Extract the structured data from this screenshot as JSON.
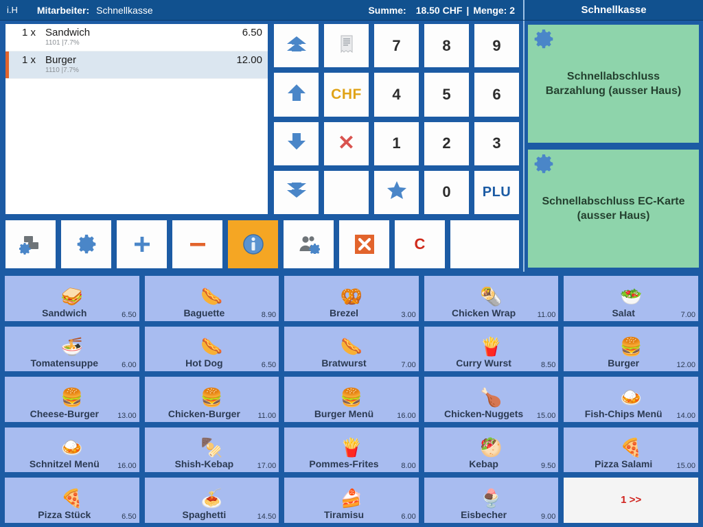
{
  "header": {
    "ih": "i.H",
    "employee_label": "Mitarbeiter:",
    "employee_value": "Schnellkasse",
    "sum_label": "Summe:",
    "sum_value": "18.50 CHF",
    "separator": "|",
    "quantity": "Menge: 2",
    "right_title": "Schnellkasse"
  },
  "receipt": {
    "lines": [
      {
        "qty": "1 x",
        "name": "Sandwich",
        "meta": "1101 |7.7%",
        "price": "6.50",
        "selected": false
      },
      {
        "qty": "1 x",
        "name": "Burger",
        "meta": "1110 |7.7%",
        "price": "12.00",
        "selected": true
      }
    ]
  },
  "keypad": {
    "keys": [
      {
        "name": "scroll-top-button",
        "icon": "double-up-arrow-icon",
        "label": ""
      },
      {
        "name": "receipt-button",
        "icon": "receipt-icon",
        "label": ""
      },
      {
        "name": "key-7",
        "icon": "",
        "label": "7"
      },
      {
        "name": "key-8",
        "icon": "",
        "label": "8"
      },
      {
        "name": "key-9",
        "icon": "",
        "label": "9"
      },
      {
        "name": "scroll-up-button",
        "icon": "up-arrow-icon",
        "label": ""
      },
      {
        "name": "currency-button",
        "icon": "",
        "label": "CHF",
        "style": "chf"
      },
      {
        "name": "key-4",
        "icon": "",
        "label": "4"
      },
      {
        "name": "key-5",
        "icon": "",
        "label": "5"
      },
      {
        "name": "key-6",
        "icon": "",
        "label": "6"
      },
      {
        "name": "scroll-down-button",
        "icon": "down-arrow-icon",
        "label": ""
      },
      {
        "name": "multiply-button",
        "icon": "",
        "label": "✕",
        "style": "xmark"
      },
      {
        "name": "key-1",
        "icon": "",
        "label": "1"
      },
      {
        "name": "key-2",
        "icon": "",
        "label": "2"
      },
      {
        "name": "key-3",
        "icon": "",
        "label": "3"
      },
      {
        "name": "scroll-bottom-button",
        "icon": "double-down-arrow-icon",
        "label": ""
      },
      {
        "name": "empty-key",
        "icon": "",
        "label": "",
        "blank": true
      },
      {
        "name": "favorite-button",
        "icon": "star-icon",
        "label": ""
      },
      {
        "name": "key-0",
        "icon": "",
        "label": "0"
      },
      {
        "name": "plu-button",
        "icon": "",
        "label": "PLU",
        "style": "plu"
      }
    ]
  },
  "toolbar": {
    "buttons": [
      {
        "name": "windows-settings-button",
        "icon": "windows-gear-icon",
        "label": "",
        "active": false
      },
      {
        "name": "settings-button",
        "icon": "gear-icon",
        "label": "",
        "active": false
      },
      {
        "name": "add-button",
        "icon": "plus-icon",
        "label": "",
        "active": false
      },
      {
        "name": "remove-button",
        "icon": "minus-icon",
        "label": "",
        "active": false
      },
      {
        "name": "info-button",
        "icon": "info-icon",
        "label": "",
        "active": true
      },
      {
        "name": "user-settings-button",
        "icon": "users-gear-icon",
        "label": "",
        "active": false
      },
      {
        "name": "cancel-button",
        "icon": "close-x-icon",
        "label": "",
        "active": false
      },
      {
        "name": "clear-button",
        "icon": "",
        "label": "C",
        "active": false
      },
      {
        "name": "empty-tool",
        "icon": "",
        "label": "",
        "active": false,
        "blank": true
      }
    ]
  },
  "quick_actions": [
    {
      "name": "quick-close-cash-button",
      "label": "Schnellabschluss Barzahlung (ausser Haus)",
      "icon": "gear-icon"
    },
    {
      "name": "quick-close-card-button",
      "label": "Schnellabschluss EC-Karte (ausser Haus)",
      "icon": "gear-icon"
    }
  ],
  "products": [
    {
      "name": "Sandwich",
      "price": "6.50",
      "emoji": "🥪"
    },
    {
      "name": "Baguette",
      "price": "8.90",
      "emoji": "🌭"
    },
    {
      "name": "Brezel",
      "price": "3.00",
      "emoji": "🥨"
    },
    {
      "name": "Chicken Wrap",
      "price": "11.00",
      "emoji": "🌯"
    },
    {
      "name": "Salat",
      "price": "7.00",
      "emoji": "🥗"
    },
    {
      "name": "Tomatensuppe",
      "price": "6.00",
      "emoji": "🍜"
    },
    {
      "name": "Hot Dog",
      "price": "6.50",
      "emoji": "🌭"
    },
    {
      "name": "Bratwurst",
      "price": "7.00",
      "emoji": "🌭"
    },
    {
      "name": "Curry Wurst",
      "price": "8.50",
      "emoji": "🍟"
    },
    {
      "name": "Burger",
      "price": "12.00",
      "emoji": "🍔"
    },
    {
      "name": "Cheese-Burger",
      "price": "13.00",
      "emoji": "🍔"
    },
    {
      "name": "Chicken-Burger",
      "price": "11.00",
      "emoji": "🍔"
    },
    {
      "name": "Burger Menü",
      "price": "16.00",
      "emoji": "🍔"
    },
    {
      "name": "Chicken-Nuggets",
      "price": "15.00",
      "emoji": "🍗"
    },
    {
      "name": "Fish-Chips Menü",
      "price": "14.00",
      "emoji": "🍛"
    },
    {
      "name": "Schnitzel Menü",
      "price": "16.00",
      "emoji": "🍛"
    },
    {
      "name": "Shish-Kebap",
      "price": "17.00",
      "emoji": "🍢"
    },
    {
      "name": "Pommes-Frites",
      "price": "8.00",
      "emoji": "🍟"
    },
    {
      "name": "Kebap",
      "price": "9.50",
      "emoji": "🥙"
    },
    {
      "name": "Pizza Salami",
      "price": "15.00",
      "emoji": "🍕"
    },
    {
      "name": "Pizza Stück",
      "price": "6.50",
      "emoji": "🍕"
    },
    {
      "name": "Spaghetti",
      "price": "14.50",
      "emoji": "🍝"
    },
    {
      "name": "Tiramisu",
      "price": "6.00",
      "emoji": "🍰"
    },
    {
      "name": "Eisbecher",
      "price": "9.00",
      "emoji": "🍨"
    }
  ],
  "pager": {
    "label": "1 >>"
  },
  "colors": {
    "frame_blue": "#1c5ba4",
    "header_blue": "#11518f",
    "tile_blue": "#a8bcf0",
    "green_button": "#8ed4ab",
    "accent_orange": "#f5a623",
    "marker_orange": "#e2642c",
    "red": "#d0211c",
    "chf_gold": "#e0a317"
  }
}
